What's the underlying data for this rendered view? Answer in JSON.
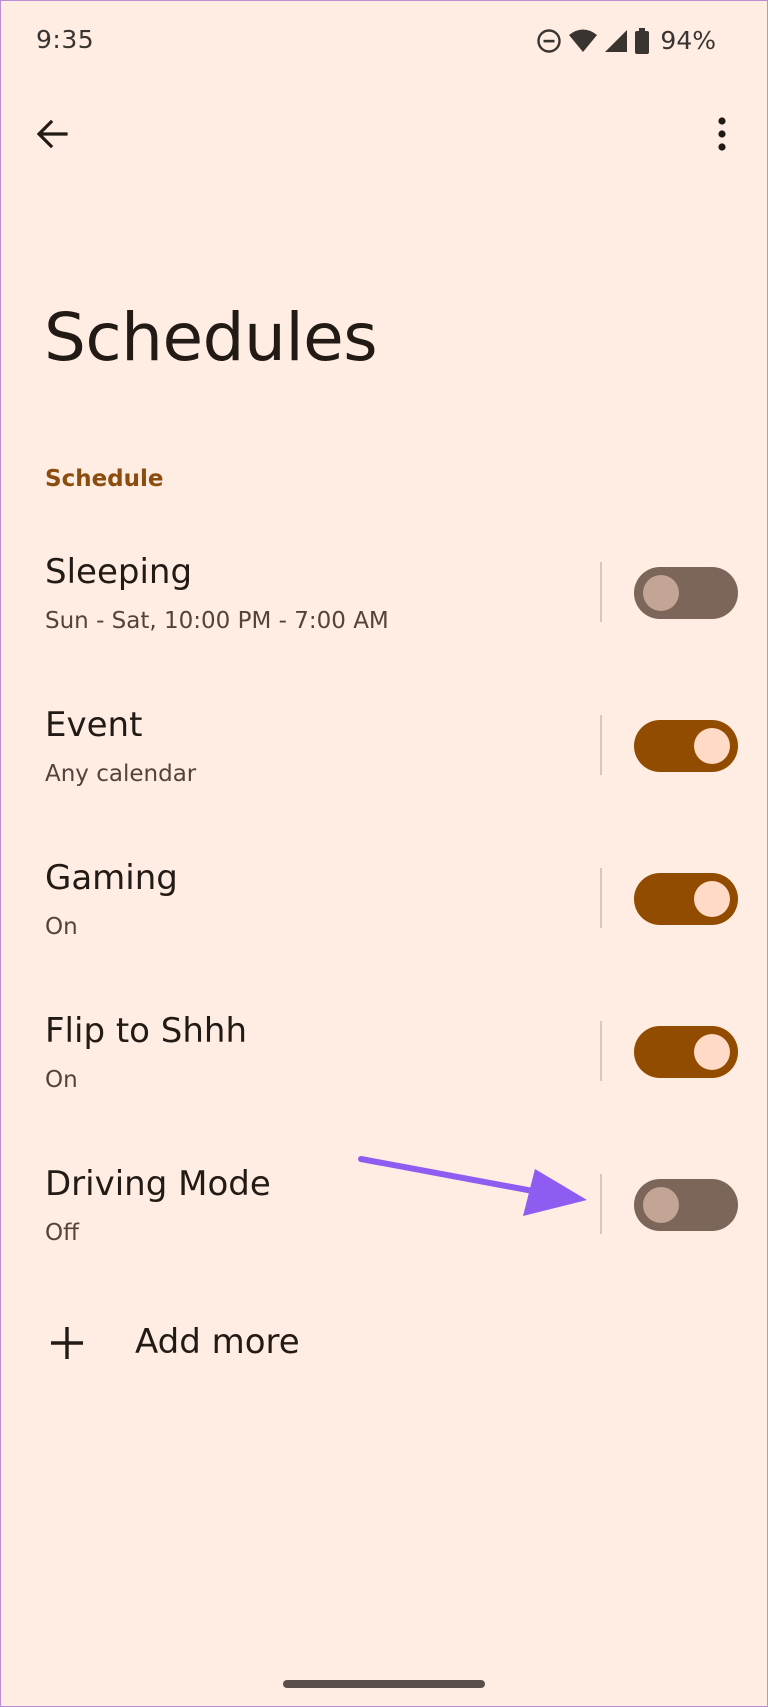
{
  "status_bar": {
    "time": "9:35",
    "battery_percent": "94%",
    "icons": [
      "do-not-disturb-icon",
      "wifi-icon",
      "signal-icon",
      "battery-icon"
    ]
  },
  "app_bar": {
    "back_icon": "arrow-back-icon",
    "overflow_icon": "more-vert-icon"
  },
  "title": "Schedules",
  "section": {
    "header": "Schedule"
  },
  "schedules": [
    {
      "title": "Sleeping",
      "summary": "Sun - Sat, 10:00 PM - 7:00 AM",
      "enabled": false
    },
    {
      "title": "Event",
      "summary": "Any calendar",
      "enabled": true
    },
    {
      "title": "Gaming",
      "summary": "On",
      "enabled": true
    },
    {
      "title": "Flip to Shhh",
      "summary": "On",
      "enabled": true
    },
    {
      "title": "Driving Mode",
      "summary": "Off",
      "enabled": false
    }
  ],
  "add_more": {
    "label": "Add more",
    "icon": "plus-icon"
  },
  "colors": {
    "background": "#ffece3",
    "accent": "#924c00",
    "section_header": "#8a4d0e",
    "toggle_off_track": "#7c6559",
    "toggle_on_thumb": "#ffdbc7",
    "annotation_arrow": "#8e5cf0"
  }
}
